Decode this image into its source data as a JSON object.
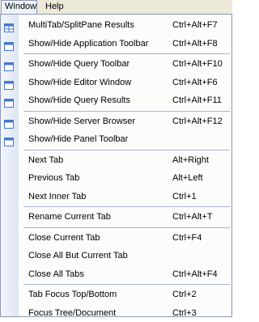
{
  "menubar": {
    "window": "Window",
    "help": "Help"
  },
  "colors": {
    "accent": "#4a78c8",
    "menu_border": "#8a98b4",
    "gutter": "#dde6f3"
  },
  "groups": [
    [
      {
        "id": "multitab",
        "label": "MultiTab/SplitPane Results",
        "shortcut": "Ctrl+Alt+F7",
        "icon": "split-pane-icon"
      },
      {
        "id": "app-toolbar",
        "label": "Show/Hide Application Toolbar",
        "shortcut": "Ctrl+Alt+F8",
        "icon": "window-icon"
      }
    ],
    [
      {
        "id": "query-toolbar",
        "label": "Show/Hide Query Toolbar",
        "shortcut": "Ctrl+Alt+F10",
        "icon": "window-icon"
      },
      {
        "id": "editor-window",
        "label": "Show/Hide Editor Window",
        "shortcut": "Ctrl+Alt+F6",
        "icon": "window-icon"
      },
      {
        "id": "query-results",
        "label": "Show/Hide Query Results",
        "shortcut": "Ctrl+Alt+F11",
        "icon": "window-icon"
      }
    ],
    [
      {
        "id": "server-browser",
        "label": "Show/Hide Server Browser",
        "shortcut": "Ctrl+Alt+F12",
        "icon": "window-icon"
      },
      {
        "id": "panel-toolbar",
        "label": "Show/Hide Panel Toolbar",
        "shortcut": "",
        "icon": "window-icon"
      }
    ],
    [
      {
        "id": "next-tab",
        "label": "Next Tab",
        "shortcut": "Alt+Right",
        "icon": ""
      },
      {
        "id": "previous-tab",
        "label": "Previous Tab",
        "shortcut": "Alt+Left",
        "icon": ""
      },
      {
        "id": "next-inner-tab",
        "label": "Next Inner Tab",
        "shortcut": "Ctrl+1",
        "icon": ""
      }
    ],
    [
      {
        "id": "rename-tab",
        "label": "Rename Current Tab",
        "shortcut": "Ctrl+Alt+T",
        "icon": ""
      }
    ],
    [
      {
        "id": "close-tab",
        "label": "Close Current Tab",
        "shortcut": "Ctrl+F4",
        "icon": ""
      },
      {
        "id": "close-all-but",
        "label": "Close All But Current Tab",
        "shortcut": "",
        "icon": ""
      },
      {
        "id": "close-all",
        "label": "Close All Tabs",
        "shortcut": "Ctrl+Alt+F4",
        "icon": ""
      }
    ],
    [
      {
        "id": "tab-focus",
        "label": "Tab Focus Top/Bottom",
        "shortcut": "Ctrl+2",
        "icon": ""
      },
      {
        "id": "focus-tree",
        "label": "Focus Tree/Document",
        "shortcut": "Ctrl+3",
        "icon": ""
      }
    ]
  ]
}
